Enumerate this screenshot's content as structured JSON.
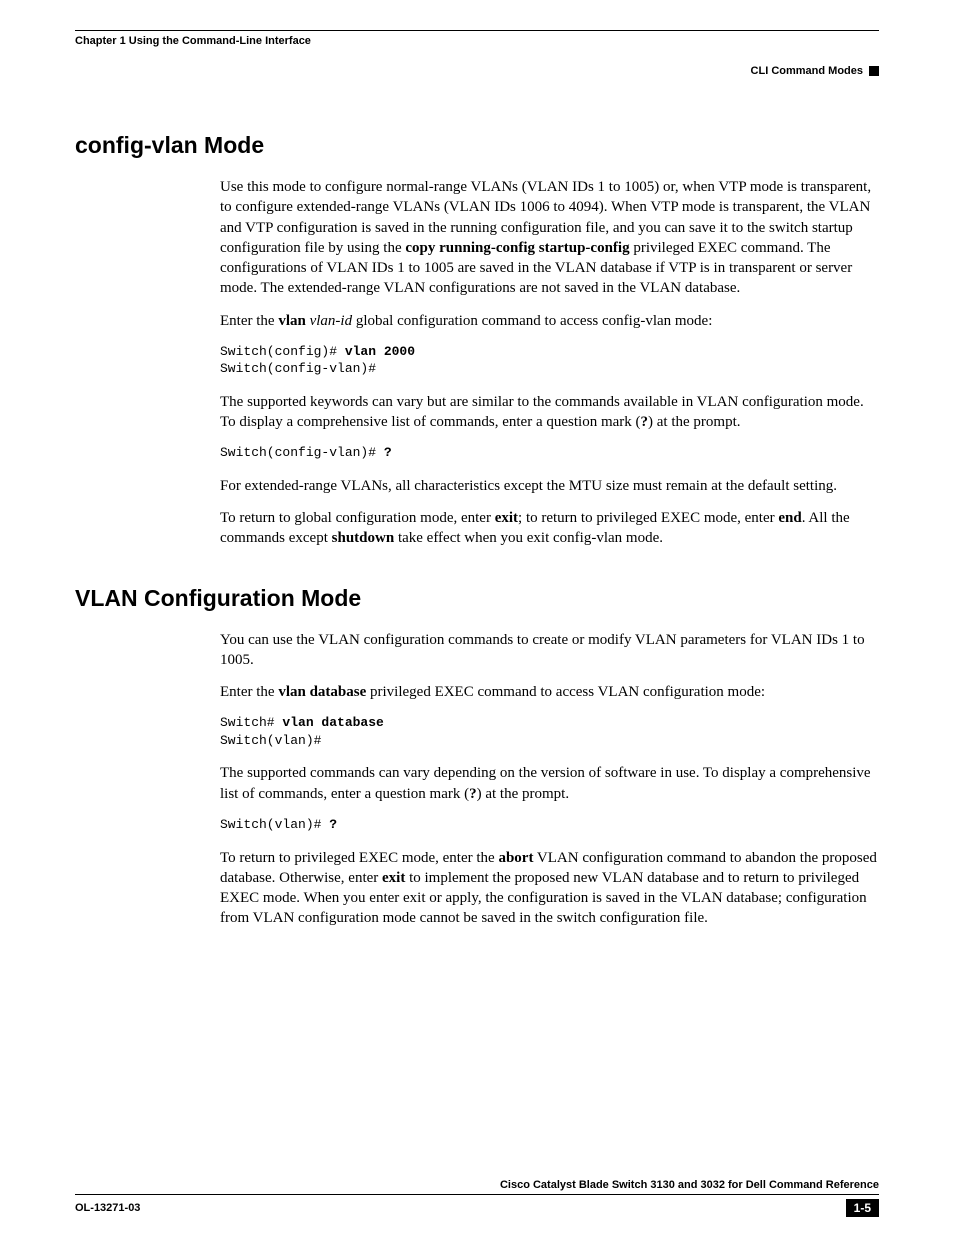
{
  "header": {
    "chapter": "Chapter 1      Using the Command-Line Interface",
    "section": "CLI Command Modes"
  },
  "s1": {
    "heading": "config-vlan Mode",
    "p1a": "Use this mode to configure normal-range VLANs (VLAN IDs 1 to 1005) or, when VTP mode is transparent, to configure extended-range VLANs (VLAN IDs 1006 to 4094). When VTP mode is transparent, the VLAN and VTP configuration is saved in the running configuration file, and you can save it to the switch startup configuration file by using the ",
    "p1b": "copy running-config startup-config",
    "p1c": " privileged EXEC command. The configurations of VLAN IDs 1 to 1005 are saved in the VLAN database if VTP is in transparent or server mode. The extended-range VLAN configurations are not saved in the VLAN database.",
    "p2a": "Enter the ",
    "p2b": "vlan",
    "p2c": " ",
    "p2d": "vlan-id",
    "p2e": " global configuration command to access config-vlan mode:",
    "code1a": "Switch(config)# ",
    "code1b": "vlan 2000",
    "code1c": "Switch(config-vlan)#",
    "p3a": "The supported keywords can vary but are similar to the commands available in VLAN configuration mode. To display a comprehensive list of commands, enter a question mark (",
    "p3b": "?",
    "p3c": ") at the prompt.",
    "code2a": "Switch(config-vlan)# ",
    "code2b": "?",
    "p4": "For extended-range VLANs, all characteristics except the MTU size must remain at the default setting.",
    "p5a": "To return to global configuration mode, enter ",
    "p5b": "exit",
    "p5c": "; to return to privileged EXEC mode, enter ",
    "p5d": "end",
    "p5e": ". All the commands except ",
    "p5f": "shutdown",
    "p5g": " take effect when you exit config-vlan mode."
  },
  "s2": {
    "heading": "VLAN Configuration Mode",
    "p1": "You can use the VLAN configuration commands to create or modify VLAN parameters for VLAN IDs 1 to 1005.",
    "p2a": "Enter the ",
    "p2b": "vlan database",
    "p2c": " privileged EXEC command to access VLAN configuration mode:",
    "code1a": "Switch# ",
    "code1b": "vlan database",
    "code1c": "Switch(vlan)#",
    "p3a": "The supported commands can vary depending on the version of software in use. To display a comprehensive list of commands, enter a question mark (",
    "p3b": "?",
    "p3c": ") at the prompt.",
    "code2a": "Switch(vlan)# ",
    "code2b": "?",
    "p4a": "To return to privileged EXEC mode, enter the ",
    "p4b": "abort",
    "p4c": " VLAN configuration command to abandon the proposed database. Otherwise, enter ",
    "p4d": "exit",
    "p4e": " to implement the proposed new VLAN database and to return to privileged EXEC mode. When you enter exit or apply, the configuration is saved in the VLAN database; configuration from VLAN configuration mode cannot be saved in the switch configuration file."
  },
  "footer": {
    "title": "Cisco Catalyst Blade Switch 3130 and 3032 for Dell Command Reference",
    "ol": "OL-13271-03",
    "page": "1-5"
  }
}
